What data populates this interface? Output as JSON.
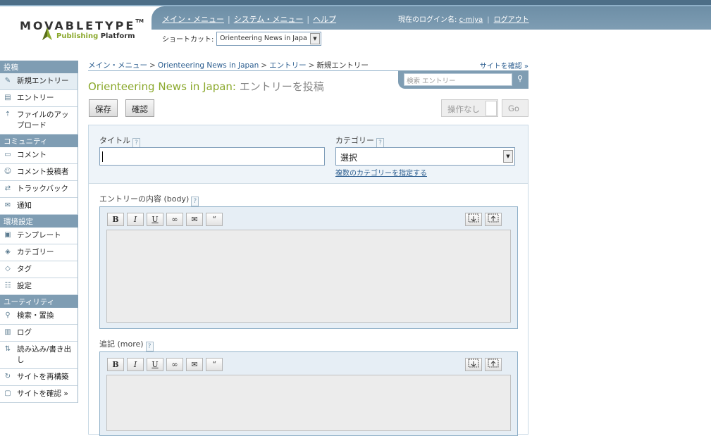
{
  "header": {
    "logo_text": "MOVABLETYPE",
    "logo_tm": "TM",
    "tagline_pub": "Publishing",
    "tagline_plat": " Platform",
    "nav": [
      "メイン・メニュー",
      "システム・メニュー",
      "ヘルプ"
    ],
    "nav_sep": "|",
    "login_label": "現在のログイン名: ",
    "login_user": "c-miya",
    "logout": "ログアウト",
    "shortcut_label": "ショートカット:",
    "shortcut_value": "Orienteering News in Japa"
  },
  "sidebar": {
    "sections": [
      {
        "title": "投稿",
        "items": [
          {
            "label": "新規エントリー",
            "icon": "✎"
          },
          {
            "label": "エントリー",
            "icon": "▤"
          },
          {
            "label": "ファイルのアップロード",
            "icon": "⇡"
          }
        ]
      },
      {
        "title": "コミュニティ",
        "items": [
          {
            "label": "コメント",
            "icon": "▭"
          },
          {
            "label": "コメント投稿者",
            "icon": "☺"
          },
          {
            "label": "トラックバック",
            "icon": "⇄"
          },
          {
            "label": "通知",
            "icon": "✉"
          }
        ]
      },
      {
        "title": "環境設定",
        "items": [
          {
            "label": "テンプレート",
            "icon": "▣"
          },
          {
            "label": "カテゴリー",
            "icon": "◈"
          },
          {
            "label": "タグ",
            "icon": "◇"
          },
          {
            "label": "設定",
            "icon": "☷"
          }
        ]
      },
      {
        "title": "ユーティリティ",
        "items": [
          {
            "label": "検索・置換",
            "icon": "⚲"
          },
          {
            "label": "ログ",
            "icon": "▥"
          },
          {
            "label": "読み込み/書き出し",
            "icon": "⇅"
          },
          {
            "label": "サイトを再構築",
            "icon": "↻"
          },
          {
            "label": "サイトを確認 »",
            "icon": "▢"
          }
        ]
      }
    ]
  },
  "breadcrumb": {
    "items": [
      "メイン・メニュー",
      "Orienteering News in Japan",
      "エントリー"
    ],
    "current": "新規エントリー",
    "sep": ">"
  },
  "view_site": "サイトを確認 »",
  "search": {
    "placeholder": "検索 エントリー",
    "icon": "search-icon"
  },
  "page_title": {
    "blog": "Orienteering News in Japan:",
    "action": " エントリーを投稿"
  },
  "buttons": {
    "save": "保存",
    "preview": "確認",
    "action_select": "操作なし",
    "go": "Go"
  },
  "form": {
    "title_label": "タイトル",
    "category_label": "カテゴリー",
    "category_value": "選択",
    "multi_category": "複数のカテゴリーを指定する",
    "body_label": "エントリーの内容 (body)",
    "more_label": "追記 (more)",
    "help": "?",
    "toolbar": [
      "B",
      "I",
      "U",
      "∞",
      "✉",
      "“"
    ]
  },
  "colors": {
    "accent": "#8aa82b",
    "nav": "#7e9db3",
    "link": "#2b5d8f"
  }
}
